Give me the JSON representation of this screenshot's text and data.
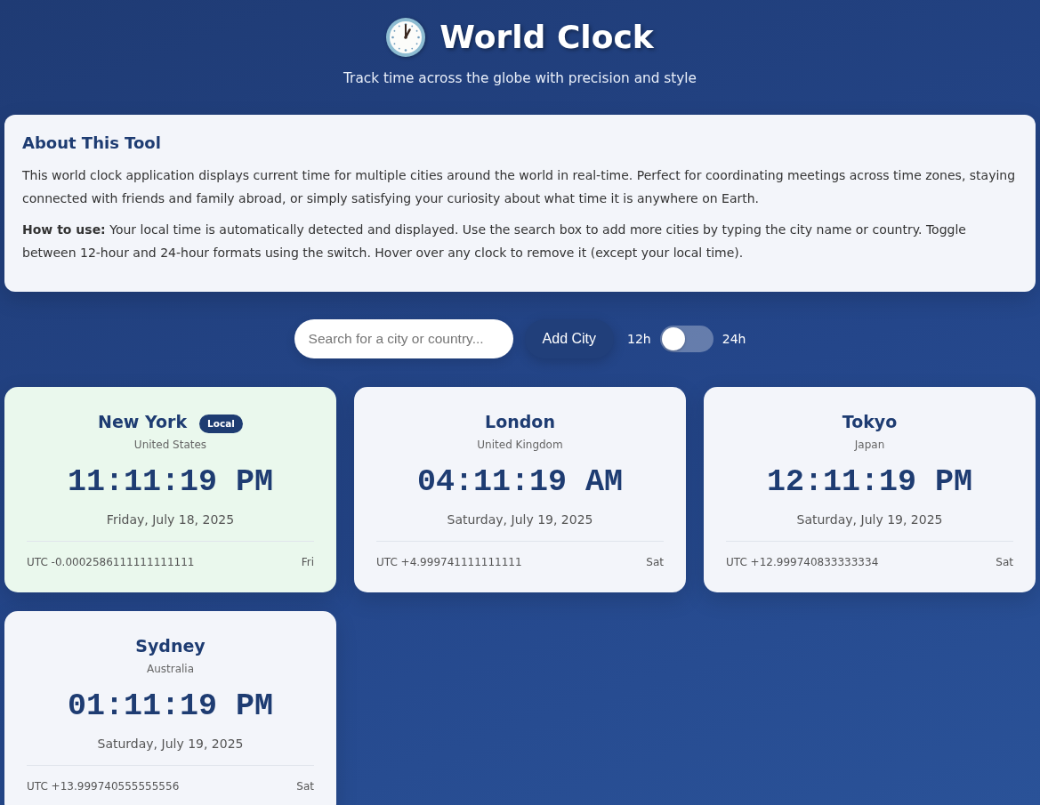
{
  "header": {
    "title": "World Clock",
    "subtitle": "Track time across the globe with precision and style"
  },
  "about": {
    "title": "About This Tool",
    "paragraphs": [
      "This world clock application displays current time for multiple cities around the world in real-time. Perfect for coordinating meetings across time zones, staying connected with friends and family abroad, or simply satisfying your curiosity about what time it is anywhere on Earth.",
      "**How to use:** Your local time is automatically detected and displayed. Use the search box to add more cities by typing the city name or country. Toggle between 12-hour and 24-hour formats using the switch. Hover over any clock to remove it (except your local time)."
    ]
  },
  "controls": {
    "search": {
      "placeholder": "Search for a city or country..."
    },
    "add_button": "Add City",
    "format_toggle": {
      "label_off": "12h",
      "label_on": "24h",
      "on": false
    }
  },
  "clocks": [
    {
      "city": "New York",
      "local": true,
      "badge": "Local",
      "country": "United States",
      "time": "11:11:19 PM",
      "date": "Friday, July 18, 2025",
      "utc_offset": "UTC -0.0002586111111111111",
      "day": "Fri"
    },
    {
      "city": "London",
      "local": false,
      "country": "United Kingdom",
      "time": "04:11:19 AM",
      "date": "Saturday, July 19, 2025",
      "utc_offset": "UTC +4.999741111111111",
      "day": "Sat"
    },
    {
      "city": "Tokyo",
      "local": false,
      "country": "Japan",
      "time": "12:11:19 PM",
      "date": "Saturday, July 19, 2025",
      "utc_offset": "UTC +12.999740833333334",
      "day": "Sat"
    },
    {
      "city": "Sydney",
      "local": false,
      "country": "Australia",
      "time": "01:11:19 PM",
      "date": "Saturday, July 19, 2025",
      "utc_offset": "UTC +13.999740555555556",
      "day": "Sat"
    }
  ]
}
